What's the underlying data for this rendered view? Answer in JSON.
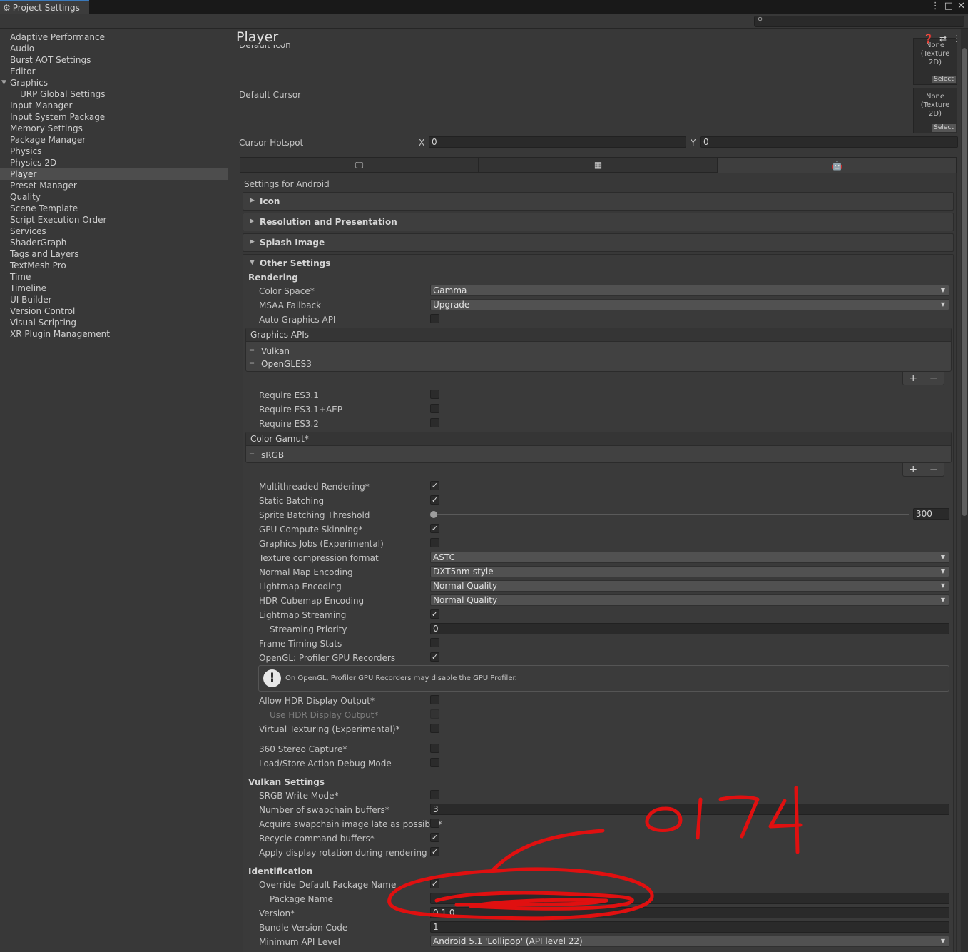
{
  "window": {
    "tab_title": "Project Settings",
    "tab_icon": "gear-icon",
    "window_controls": [
      "more-icon",
      "maximize-icon",
      "close-icon"
    ]
  },
  "sidebar": {
    "items": [
      {
        "label": "Adaptive Performance"
      },
      {
        "label": "Audio"
      },
      {
        "label": "Burst AOT Settings"
      },
      {
        "label": "Editor"
      },
      {
        "label": "Graphics",
        "expanded": true
      },
      {
        "label": "URP Global Settings",
        "child": true
      },
      {
        "label": "Input Manager"
      },
      {
        "label": "Input System Package"
      },
      {
        "label": "Memory Settings"
      },
      {
        "label": "Package Manager"
      },
      {
        "label": "Physics"
      },
      {
        "label": "Physics 2D"
      },
      {
        "label": "Player",
        "selected": true
      },
      {
        "label": "Preset Manager"
      },
      {
        "label": "Quality"
      },
      {
        "label": "Scene Template"
      },
      {
        "label": "Script Execution Order"
      },
      {
        "label": "Services"
      },
      {
        "label": "ShaderGraph"
      },
      {
        "label": "Tags and Layers"
      },
      {
        "label": "TextMesh Pro"
      },
      {
        "label": "Time"
      },
      {
        "label": "Timeline"
      },
      {
        "label": "UI Builder"
      },
      {
        "label": "Version Control"
      },
      {
        "label": "Visual Scripting"
      },
      {
        "label": "XR Plugin Management"
      }
    ]
  },
  "main": {
    "title": "Player",
    "default_icon_label": "Default Icon",
    "default_cursor_label": "Default Cursor",
    "texture_slot_text_1": "None",
    "texture_slot_text_2": "(Texture 2D)",
    "select_label": "Select",
    "cursor_hotspot": {
      "label": "Cursor Hotspot",
      "x_label": "X",
      "x_value": "0",
      "y_label": "Y",
      "y_value": "0"
    },
    "platform_tabs": [
      "desktop-icon",
      "webgl-icon",
      "android-icon"
    ],
    "settings_for": "Settings for Android",
    "foldouts": {
      "icon": "Icon",
      "resolution": "Resolution and Presentation",
      "splash": "Splash Image",
      "other": "Other Settings"
    },
    "rendering": {
      "header": "Rendering",
      "color_space": {
        "label": "Color Space*",
        "value": "Gamma"
      },
      "msaa_fallback": {
        "label": "MSAA Fallback",
        "value": "Upgrade"
      },
      "auto_graphics_api": {
        "label": "Auto Graphics API",
        "checked": false
      },
      "graphics_apis": {
        "header": "Graphics APIs",
        "items": [
          "Vulkan",
          "OpenGLES3"
        ]
      },
      "require_es31": {
        "label": "Require ES3.1",
        "checked": false
      },
      "require_es31_aep": {
        "label": "Require ES3.1+AEP",
        "checked": false
      },
      "require_es32": {
        "label": "Require ES3.2",
        "checked": false
      },
      "color_gamut": {
        "header": "Color Gamut*",
        "items": [
          "sRGB"
        ]
      },
      "multithreaded_rendering": {
        "label": "Multithreaded Rendering*",
        "checked": true
      },
      "static_batching": {
        "label": "Static Batching",
        "checked": true
      },
      "sprite_batching_threshold": {
        "label": "Sprite Batching Threshold",
        "value": "300",
        "fraction": 0.0
      },
      "gpu_compute_skinning": {
        "label": "GPU Compute Skinning*",
        "checked": true
      },
      "graphics_jobs": {
        "label": "Graphics Jobs (Experimental)",
        "checked": false
      },
      "texture_compression": {
        "label": "Texture compression format",
        "value": "ASTC"
      },
      "normal_map_encoding": {
        "label": "Normal Map Encoding",
        "value": "DXT5nm-style"
      },
      "lightmap_encoding": {
        "label": "Lightmap Encoding",
        "value": "Normal Quality"
      },
      "hdr_cubemap_encoding": {
        "label": "HDR Cubemap Encoding",
        "value": "Normal Quality"
      },
      "lightmap_streaming": {
        "label": "Lightmap Streaming",
        "checked": true
      },
      "streaming_priority": {
        "label": "Streaming Priority",
        "value": "0"
      },
      "frame_timing_stats": {
        "label": "Frame Timing Stats",
        "checked": false
      },
      "opengl_profiler": {
        "label": "OpenGL: Profiler GPU Recorders",
        "checked": true
      },
      "help_text": "On OpenGL, Profiler GPU Recorders may disable the GPU Profiler.",
      "allow_hdr_output": {
        "label": "Allow HDR Display Output*",
        "checked": false
      },
      "use_hdr_output": {
        "label": "Use HDR Display Output*",
        "checked": false
      },
      "virtual_texturing": {
        "label": "Virtual Texturing (Experimental)*",
        "checked": false
      },
      "stereo_360": {
        "label": "360 Stereo Capture*",
        "checked": false
      },
      "load_store_debug": {
        "label": "Load/Store Action Debug Mode",
        "checked": false
      }
    },
    "vulkan": {
      "header": "Vulkan Settings",
      "srgb_write": {
        "label": "SRGB Write Mode*",
        "checked": false
      },
      "swapchain_buffers": {
        "label": "Number of swapchain buffers*",
        "value": "3"
      },
      "acquire_late": {
        "label": "Acquire swapchain image late as possible*",
        "checked": false
      },
      "recycle_buffers": {
        "label": "Recycle command buffers*",
        "checked": true
      },
      "display_rotation": {
        "label": "Apply display rotation during rendering",
        "checked": true
      }
    },
    "identification": {
      "header": "Identification",
      "override_package": {
        "label": "Override Default Package Name",
        "checked": true
      },
      "package_name": {
        "label": "Package Name"
      },
      "version": {
        "label": "Version*",
        "value": "0.1.0"
      },
      "bundle_version_code": {
        "label": "Bundle Version Code",
        "value": "1"
      },
      "min_api_level": {
        "label": "Minimum API Level",
        "value": "Android 5.1 'Lollipop' (API level 22)"
      }
    }
  },
  "annotation": {
    "handwritten_text": "0174",
    "color": "#e01010"
  }
}
